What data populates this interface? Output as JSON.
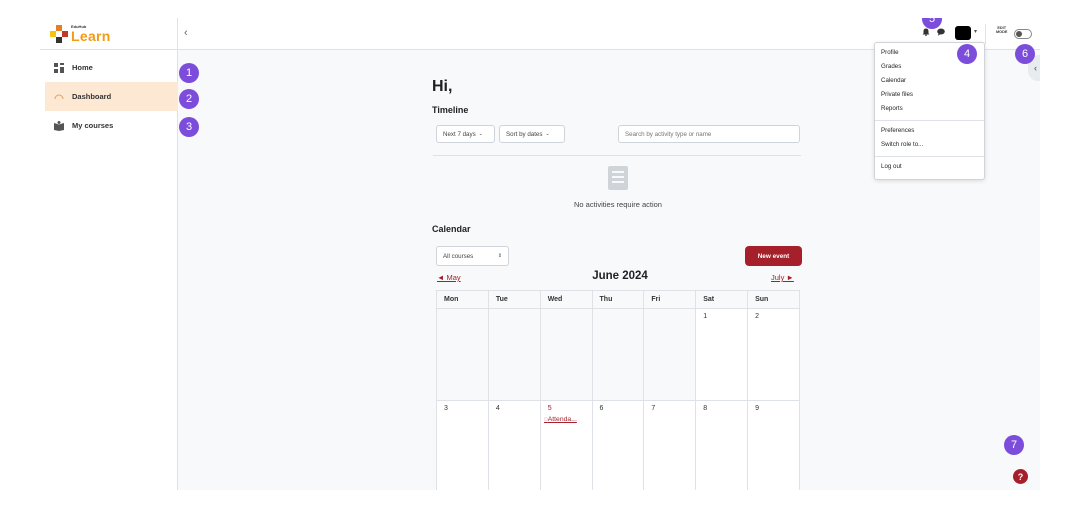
{
  "brand": {
    "small_text": "EduHub",
    "name": "Learn"
  },
  "sidebar": {
    "items": [
      {
        "label": "Home"
      },
      {
        "label": "Dashboard"
      },
      {
        "label": "My courses"
      }
    ]
  },
  "header": {
    "collapse_glyph": "‹",
    "edit_mode_line1": "EDIT",
    "edit_mode_line2": "MODE"
  },
  "main": {
    "greeting": "Hi,",
    "timeline": {
      "title": "Timeline",
      "range_select": "Next 7 days",
      "sort_select": "Sort by dates",
      "search_placeholder": "Search by activity type or name",
      "empty_message": "No activities require action"
    },
    "calendar": {
      "title": "Calendar",
      "course_select": "All courses",
      "new_event_label": "New event",
      "prev_month": "◄ May",
      "next_month": "July ►",
      "month_title": "June 2024",
      "weekdays": [
        "Mon",
        "Tue",
        "Wed",
        "Thu",
        "Fri",
        "Sat",
        "Sun"
      ],
      "week1": [
        "",
        "",
        "",
        "",
        "",
        "1",
        "2"
      ],
      "week2": [
        "3",
        "4",
        "5",
        "6",
        "7",
        "8",
        "9"
      ],
      "event_label": "Attenda..."
    }
  },
  "user_menu": {
    "items": [
      "Profile",
      "Grades",
      "Calendar",
      "Private files",
      "Reports",
      "Preferences",
      "Switch role to...",
      "Log out"
    ]
  },
  "help_label": "?",
  "badges": [
    "1",
    "2",
    "3",
    "4",
    "5",
    "6",
    "7"
  ],
  "colors": {
    "accent": "#a5202a",
    "active_nav_bg": "#fde8d4",
    "badge": "#7c4ddb",
    "logo": "#f39c12"
  }
}
